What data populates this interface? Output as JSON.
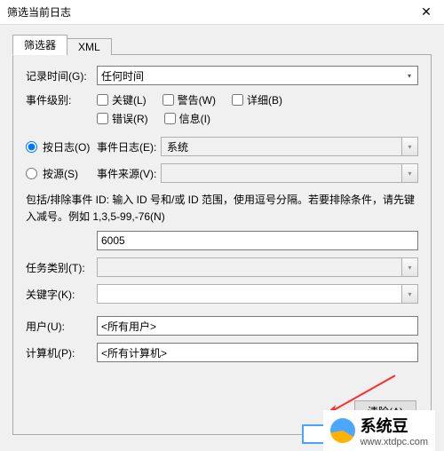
{
  "window": {
    "title": "筛选当前日志"
  },
  "tabs": {
    "filter": "筛选器",
    "xml": "XML"
  },
  "labels": {
    "log_time": "记录时间(G):",
    "event_level": "事件级别:",
    "by_log": "按日志(O)",
    "by_source": "按源(S)",
    "event_log": "事件日志(E):",
    "event_source": "事件来源(V):",
    "task_category": "任务类别(T):",
    "keywords": "关键字(K):",
    "user": "用户(U):",
    "computer": "计算机(P):"
  },
  "values": {
    "time": "任何时间",
    "event_log": "系统",
    "event_source": "",
    "event_id": "6005",
    "task_category": "",
    "keywords": "",
    "user": "<所有用户>",
    "computer": "<所有计算机>"
  },
  "checkboxes": {
    "critical": "关键(L)",
    "warning": "警告(W)",
    "verbose": "详细(B)",
    "error": "错误(R)",
    "information": "信息(I)"
  },
  "instruction": "包括/排除事件 ID: 输入 ID 号和/或 ID 范围，使用逗号分隔。若要排除条件，请先键入减号。例如 1,3,5-99,-76(N)",
  "buttons": {
    "clear": "清除(A)"
  },
  "watermark": {
    "name": "系统豆",
    "url": "www.xtdpc.com"
  }
}
